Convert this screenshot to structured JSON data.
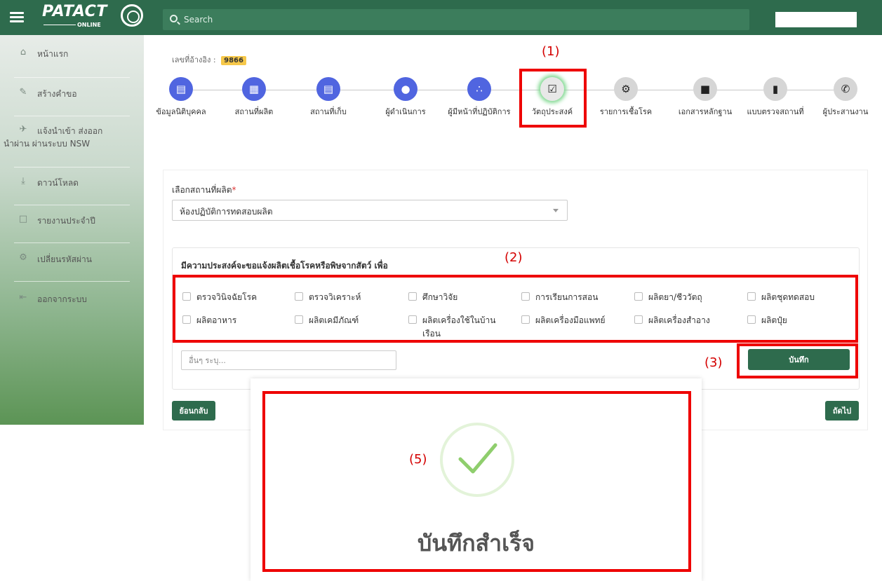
{
  "header": {
    "logo_text": "PATACT",
    "logo_sub": "ONLINE",
    "search_placeholder": "Search"
  },
  "sidebar": {
    "items": [
      {
        "label": "หน้าแรก",
        "icon": "home-icon"
      },
      {
        "label": "สร้างคำขอ",
        "icon": "pencil-icon"
      },
      {
        "label": "แจ้งนำเข้า ส่งออก",
        "label2": "นำผ่าน ผ่านระบบ NSW",
        "icon": "plane-icon"
      },
      {
        "label": "ดาวน์โหลด",
        "icon": "download-icon"
      },
      {
        "label": "รายงานประจำปี",
        "icon": "file-icon"
      },
      {
        "label": "เปลี่ยนรหัสผ่าน",
        "icon": "gears-icon"
      },
      {
        "label": "ออกจากระบบ",
        "icon": "logout-icon"
      }
    ]
  },
  "reference": {
    "label": "เลขที่อ้างอิง :",
    "value": "9866"
  },
  "steps": [
    {
      "label": "ข้อมูลนิติบุคคล",
      "icon": "id-card-icon",
      "state": "done"
    },
    {
      "label": "สถานที่ผลิต",
      "icon": "building-icon",
      "state": "done"
    },
    {
      "label": "สถานที่เก็บ",
      "icon": "archive-icon",
      "state": "done"
    },
    {
      "label": "ผู้ดำเนินการ",
      "icon": "user-icon",
      "state": "done"
    },
    {
      "label": "ผู้มีหน้าที่ปฏิบัติการ",
      "icon": "users-icon",
      "state": "done"
    },
    {
      "label": "วัตถุประสงค์",
      "icon": "check-square-icon",
      "state": "active"
    },
    {
      "label": "รายการเชื้อโรค",
      "icon": "cogs-icon",
      "state": "pending"
    },
    {
      "label": "เอกสารหลักฐาน",
      "icon": "document-icon",
      "state": "pending"
    },
    {
      "label": "แบบตรวจสถานที่",
      "icon": "clipboard-icon",
      "state": "pending"
    },
    {
      "label": "ผู้ประสานงาน",
      "icon": "phone-icon",
      "state": "pending"
    }
  ],
  "form": {
    "site_label": "เลือกสถานที่ผลิต",
    "required_mark": "*",
    "site_value": "ห้องปฏิบัติการทดสอบผลิต",
    "purpose_title": "มีความประสงค์จะขอแจ้งผลิตเชื้อโรคหรือพิษจากสัตว์ เพื่อ",
    "purposes": [
      "ตรวจวินิจฉัยโรค",
      "ตรวจวิเคราะห์",
      "ศึกษาวิจัย",
      "การเรียนการสอน",
      "ผลิตยา/ชีววัตถุ",
      "ผลิตชุดทดสอบ",
      "ผลิตอาหาร",
      "ผลิตเคมีภัณฑ์",
      "ผลิตเครื่องใช้ในบ้าน เรือน",
      "ผลิตเครื่องมือแพทย์",
      "ผลิตเครื่องสำอาง",
      "ผลิตปุ๋ย"
    ],
    "other_placeholder": "อื่นๆ ระบุ...",
    "save_label": "บันทึก",
    "back_label": "ย้อนกลับ",
    "next_label": "ถัดไป"
  },
  "annotations": {
    "n1": "(1)",
    "n2": "(2)",
    "n3": "(3)",
    "n5": "(5)"
  },
  "modal": {
    "message": "บันทึกสำเร็จ"
  },
  "colors": {
    "brand_green": "#2e6b4d",
    "step_blue": "#5065e0",
    "annotation_red": "#ee0000",
    "badge_yellow": "#f6c84a"
  }
}
